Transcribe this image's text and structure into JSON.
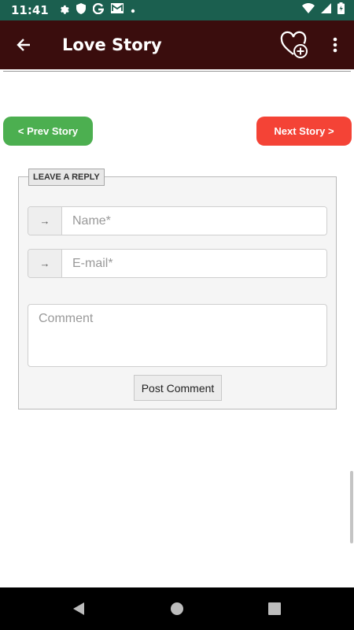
{
  "status_bar": {
    "time": "11:41",
    "left_icons": [
      "gear-icon",
      "shield-icon",
      "google-icon",
      "mail-icon",
      "dot-icon"
    ],
    "right_icons": [
      "wifi-icon",
      "signal-icon",
      "battery-icon"
    ]
  },
  "app_bar": {
    "title": "Love Story",
    "back_icon": "arrow-back-icon",
    "fav_icon": "heart-add-icon",
    "menu_icon": "more-vert-icon"
  },
  "navigation": {
    "prev_label": "< Prev Story",
    "next_label": "Next Story >",
    "prev_color": "#4caf50",
    "next_color": "#f44336"
  },
  "reply_form": {
    "legend": "LEAVE A REPLY",
    "name_addon": "→",
    "name_placeholder": "Name*",
    "email_addon": "→",
    "email_placeholder": "E-mail*",
    "comment_placeholder": "Comment",
    "submit_label": "Post Comment"
  },
  "colors": {
    "status_bar": "#1b5f4f",
    "app_bar": "#3a0d0d"
  }
}
